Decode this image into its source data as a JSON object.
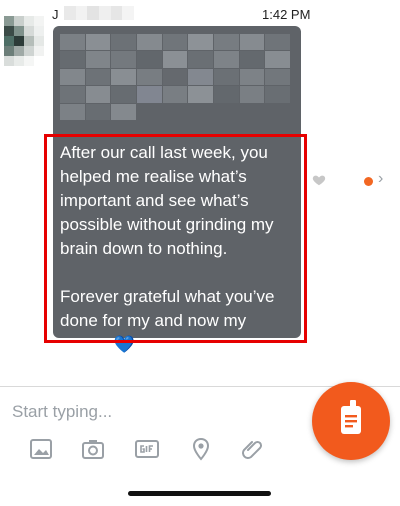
{
  "header": {
    "sender_initial": "J",
    "time": "1:42 PM"
  },
  "message": {
    "text": "After our call last week, you helped me realise what’s important and see what’s possible without grinding my brain down to nothing.\n\nForever grateful what you’ve done for my and now my family! 💙"
  },
  "composer": {
    "placeholder": "Start typing...",
    "tools": [
      "image-icon",
      "camera-icon",
      "gif-icon",
      "location-pin-icon",
      "paperclip-icon"
    ]
  },
  "colors": {
    "bubble": "#5f6368",
    "highlight": "#e60000",
    "accent": "#f25a1d",
    "unread_dot": "#f26722"
  }
}
